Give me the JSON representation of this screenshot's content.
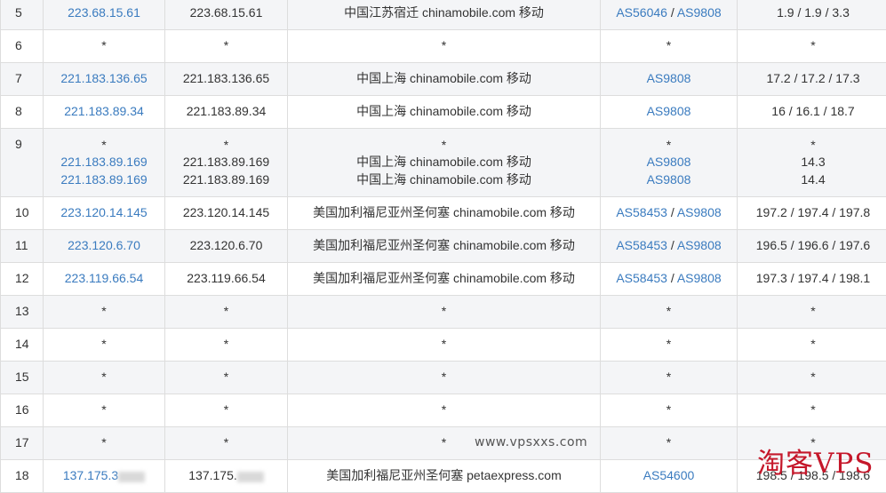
{
  "rows": [
    {
      "hop": "5",
      "ip": "223.68.15.61",
      "host": "223.68.15.61",
      "location": "中国江苏宿迁 chinamobile.com 移动",
      "asn": [
        "AS56046",
        "AS9808"
      ],
      "rtt": "1.9 / 1.9 / 3.3"
    },
    {
      "hop": "6",
      "ip": "*",
      "host": "*",
      "location": "*",
      "asn": "*",
      "rtt": "*"
    },
    {
      "hop": "7",
      "ip": "221.183.136.65",
      "host": "221.183.136.65",
      "location": "中国上海 chinamobile.com 移动",
      "asn": [
        "AS9808"
      ],
      "rtt": "17.2 / 17.2 / 17.3"
    },
    {
      "hop": "8",
      "ip": "221.183.89.34",
      "host": "221.183.89.34",
      "location": "中国上海 chinamobile.com 移动",
      "asn": [
        "AS9808"
      ],
      "rtt": "16 / 16.1 / 18.7"
    },
    {
      "hop": "9",
      "lines": [
        {
          "ip": "*",
          "host": "*",
          "location": "*",
          "asn": "*",
          "rtt": "*"
        },
        {
          "ip": "221.183.89.169",
          "host": "221.183.89.169",
          "location": "中国上海 chinamobile.com 移动",
          "asn": "AS9808",
          "rtt": "14.3"
        },
        {
          "ip": "221.183.89.169",
          "host": "221.183.89.169",
          "location": "中国上海 chinamobile.com 移动",
          "asn": "AS9808",
          "rtt": "14.4"
        }
      ]
    },
    {
      "hop": "10",
      "ip": "223.120.14.145",
      "host": "223.120.14.145",
      "location": "美国加利福尼亚州圣何塞 chinamobile.com 移动",
      "asn": [
        "AS58453",
        "AS9808"
      ],
      "rtt": "197.2 / 197.4 / 197.8"
    },
    {
      "hop": "11",
      "ip": "223.120.6.70",
      "host": "223.120.6.70",
      "location": "美国加利福尼亚州圣何塞 chinamobile.com 移动",
      "asn": [
        "AS58453",
        "AS9808"
      ],
      "rtt": "196.5 / 196.6 / 197.6"
    },
    {
      "hop": "12",
      "ip": "223.119.66.54",
      "host": "223.119.66.54",
      "location": "美国加利福尼亚州圣何塞 chinamobile.com 移动",
      "asn": [
        "AS58453",
        "AS9808"
      ],
      "rtt": "197.3 / 197.4 / 198.1"
    },
    {
      "hop": "13",
      "ip": "*",
      "host": "*",
      "location": "*",
      "asn": "*",
      "rtt": "*"
    },
    {
      "hop": "14",
      "ip": "*",
      "host": "*",
      "location": "*",
      "asn": "*",
      "rtt": "*"
    },
    {
      "hop": "15",
      "ip": "*",
      "host": "*",
      "location": "*",
      "asn": "*",
      "rtt": "*"
    },
    {
      "hop": "16",
      "ip": "*",
      "host": "*",
      "location": "*",
      "asn": "*",
      "rtt": "*"
    },
    {
      "hop": "17",
      "ip": "*",
      "host": "*",
      "location": "*",
      "asn": "*",
      "rtt": "*"
    },
    {
      "hop": "18",
      "ip": "137.175.3",
      "host": "137.175.",
      "location": "美国加利福尼亚州圣何塞 petaexpress.com",
      "asn": [
        "AS54600"
      ],
      "rtt": "198.5 / 198.5 / 198.6"
    }
  ],
  "watermarks": {
    "site": "www.vpsxxs.com",
    "brand": "淘客VPS"
  },
  "colors": {
    "link": "#3a7bbf",
    "row_alt": "#f4f5f7",
    "border": "#dddddd",
    "brand_red": "#c5172a"
  }
}
